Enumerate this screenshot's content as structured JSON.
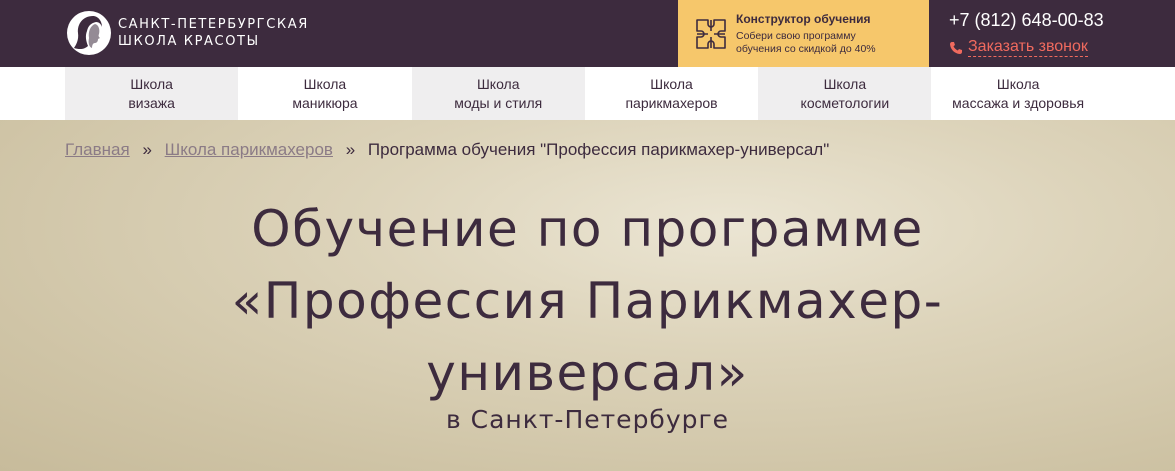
{
  "header": {
    "logo": {
      "line1": "САНКТ-ПЕТЕРБУРГСКАЯ",
      "line2": "ШКОЛА КРАСОТЫ",
      "icon": "woman-silhouette-icon"
    },
    "builder": {
      "title": "Конструктор обучения",
      "desc_line1": "Собери свою программу",
      "desc_line2": "обучения со скидкой до 40%",
      "icon": "puzzle-icon"
    },
    "phone": "+7 (812) 648-00-83",
    "callback_label": "Заказать звонок",
    "callback_icon": "phone-icon"
  },
  "nav": {
    "items": [
      {
        "line1": "Школа",
        "line2": "визажа"
      },
      {
        "line1": "Школа",
        "line2": "маникюра"
      },
      {
        "line1": "Школа",
        "line2": "моды и стиля"
      },
      {
        "line1": "Школа",
        "line2": "парикмахеров"
      },
      {
        "line1": "Школа",
        "line2": "косметологии"
      },
      {
        "line1": "Школа",
        "line2": "массажа и здоровья"
      }
    ]
  },
  "breadcrumb": {
    "home": "Главная",
    "separator": "»",
    "section": "Школа парикмахеров",
    "current": "Программа обучения \"Профессия парикмахер-универсал\""
  },
  "hero": {
    "title_line1": "Обучение по программе",
    "title_line2": "«Профессия Парикмахер-",
    "title_line3": "универсал»",
    "subtitle": "в Санкт-Петербурге"
  },
  "colors": {
    "header_bg": "#3d2b3e",
    "accent_yellow": "#f6c76b",
    "callback_red": "#f06a5e",
    "hero_bg": "#d6cdb2"
  }
}
